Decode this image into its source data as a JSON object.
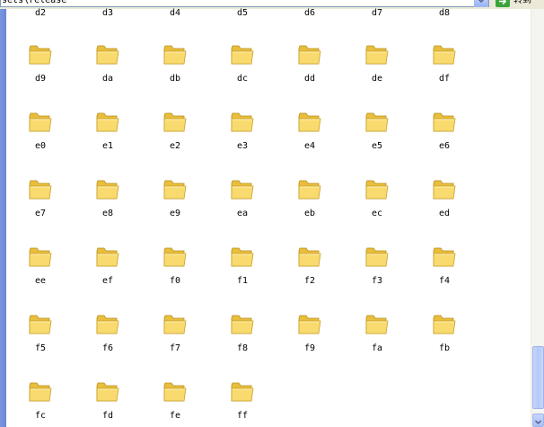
{
  "address": {
    "path": "sets\\release",
    "go_label": "转到"
  },
  "content": {
    "top_partial_row": [
      "d2",
      "d3",
      "d4",
      "d5",
      "d6",
      "d7",
      "d8"
    ],
    "folders": [
      "d9",
      "da",
      "db",
      "dc",
      "dd",
      "de",
      "df",
      "e0",
      "e1",
      "e2",
      "e3",
      "e4",
      "e5",
      "e6",
      "e7",
      "e8",
      "e9",
      "ea",
      "eb",
      "ec",
      "ed",
      "ee",
      "ef",
      "f0",
      "f1",
      "f2",
      "f3",
      "f4",
      "f5",
      "f6",
      "f7",
      "f8",
      "f9",
      "fa",
      "fb",
      "fc",
      "fd",
      "fe",
      "ff"
    ]
  },
  "colors": {
    "folder_front": "#f8da6e",
    "folder_back": "#e9be3c",
    "pane_strip": "#6c87d8"
  }
}
